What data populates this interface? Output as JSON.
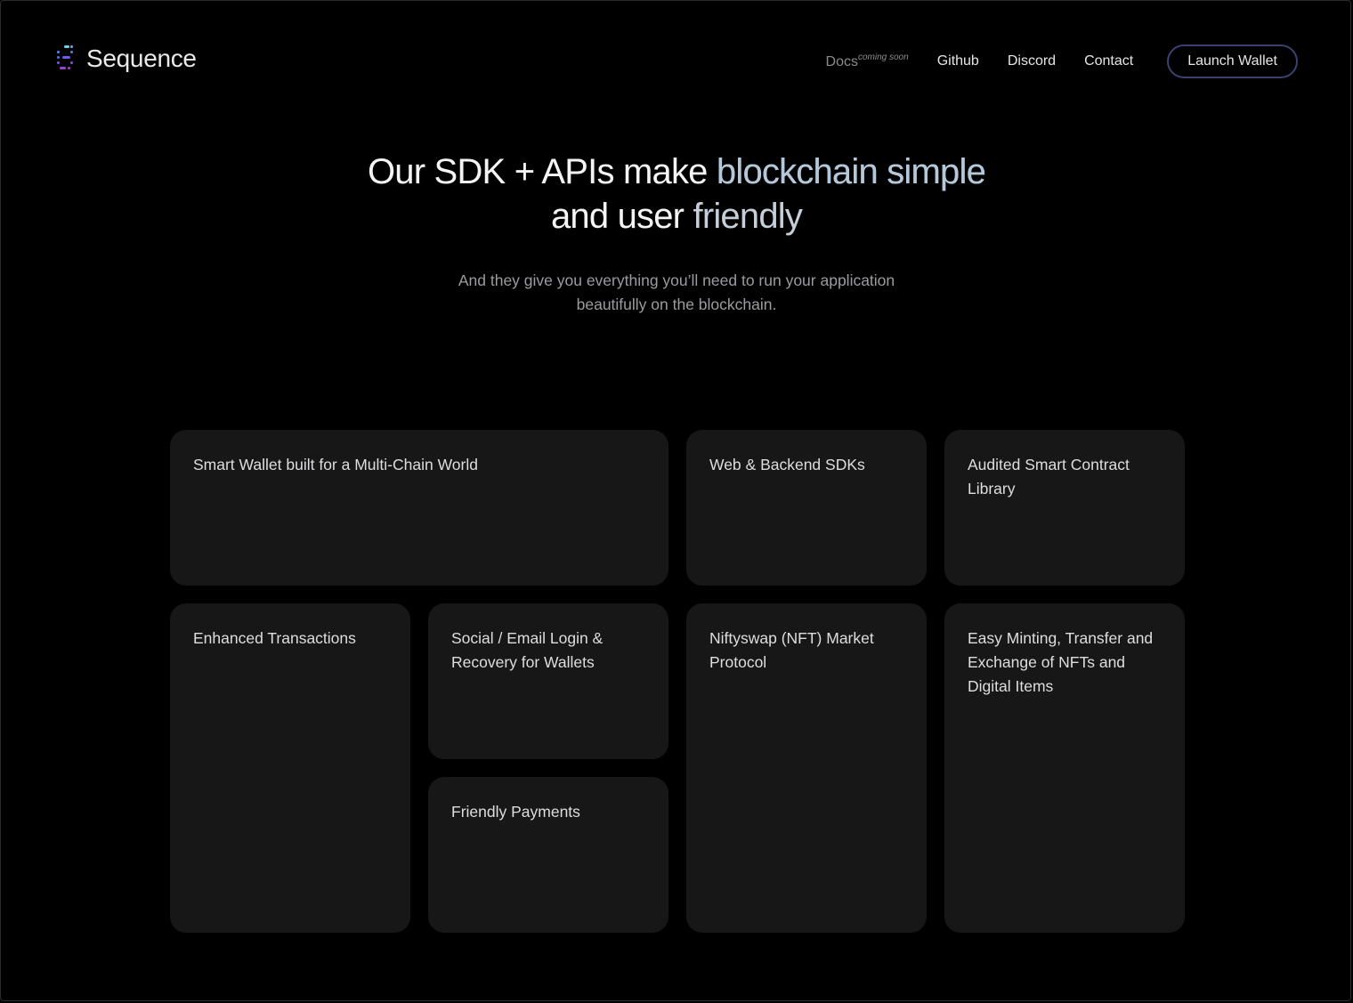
{
  "header": {
    "brand": "Sequence",
    "nav": {
      "docs": "Docs",
      "docs_badge": "coming soon",
      "github": "Github",
      "discord": "Discord",
      "contact": "Contact"
    },
    "launch_button": "Launch Wallet"
  },
  "hero": {
    "title_plain_1": "Our SDK + APIs make ",
    "title_accent_1": "blockchain simple",
    "title_plain_2": "and user ",
    "title_accent_2": "friendly",
    "subtitle": "And they give you everything you’ll need to run your application beautifully on the blockchain."
  },
  "features": {
    "smart_wallet": "Smart Wallet built for a Multi-Chain World",
    "sdks": "Web & Backend SDKs",
    "contract_library": "Audited Smart Contract Library",
    "enhanced_tx": "Enhanced Transactions",
    "social_login": "Social / Email Login & Recovery for Wallets",
    "niftyswap": "Niftyswap (NFT) Market Protocol",
    "minting": "Easy Minting, Transfer and Exchange of NFTs and Digital Items",
    "payments": "Friendly Payments"
  },
  "colors": {
    "background": "#000000",
    "card": "#171717",
    "accent_text": "#b4c8da",
    "button_border": "#3a4270"
  },
  "icons": {
    "logo": "sequence-logo-icon"
  }
}
